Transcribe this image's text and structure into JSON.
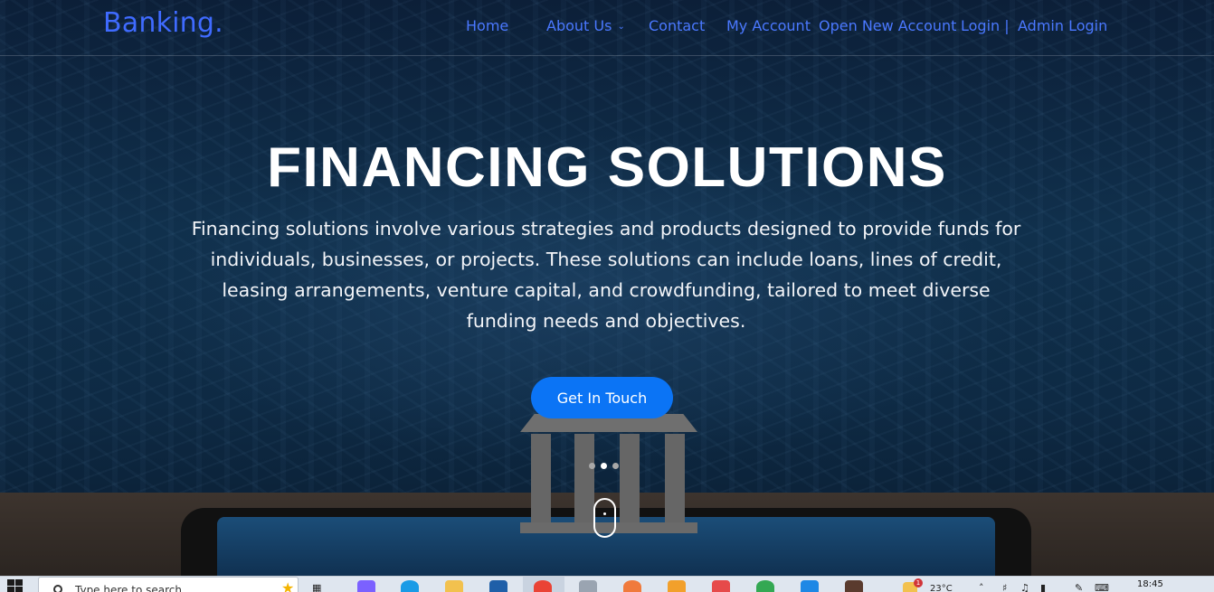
{
  "brand": "Banking.",
  "nav": {
    "home": "Home",
    "about": "About Us",
    "contact": "Contact",
    "my_account": "My Account",
    "open_account": "Open New Account",
    "login": "Login |",
    "admin_login": "Admin Login"
  },
  "hero": {
    "title": "FINANCING SOLUTIONS",
    "text": "Financing solutions involve various strategies and products designed to provide funds for individuals, businesses, or projects. These solutions can include loans, lines of credit, leasing arrangements, venture capital, and crowdfunding, tailored to meet diverse funding needs and objectives.",
    "cta": "Get In Touch",
    "slides": 3,
    "active_slide": 2
  },
  "taskbar": {
    "search_placeholder": "Type here to search",
    "temperature": "23°C",
    "notification_count": "1",
    "time": "18:45",
    "app_colors": [
      "#7b61ff",
      "#1a9be6",
      "#f2c14e",
      "#1f5fa8",
      "#ea4335",
      "#9aa4b1",
      "#f07a3c",
      "#f2a02b",
      "#e64a4a",
      "#34a853",
      "#1e88e5",
      "#5a3b2e"
    ]
  },
  "colors": {
    "brand": "#3f6bff",
    "nav_link": "#4a78ff",
    "cta": "#0b74f5"
  }
}
